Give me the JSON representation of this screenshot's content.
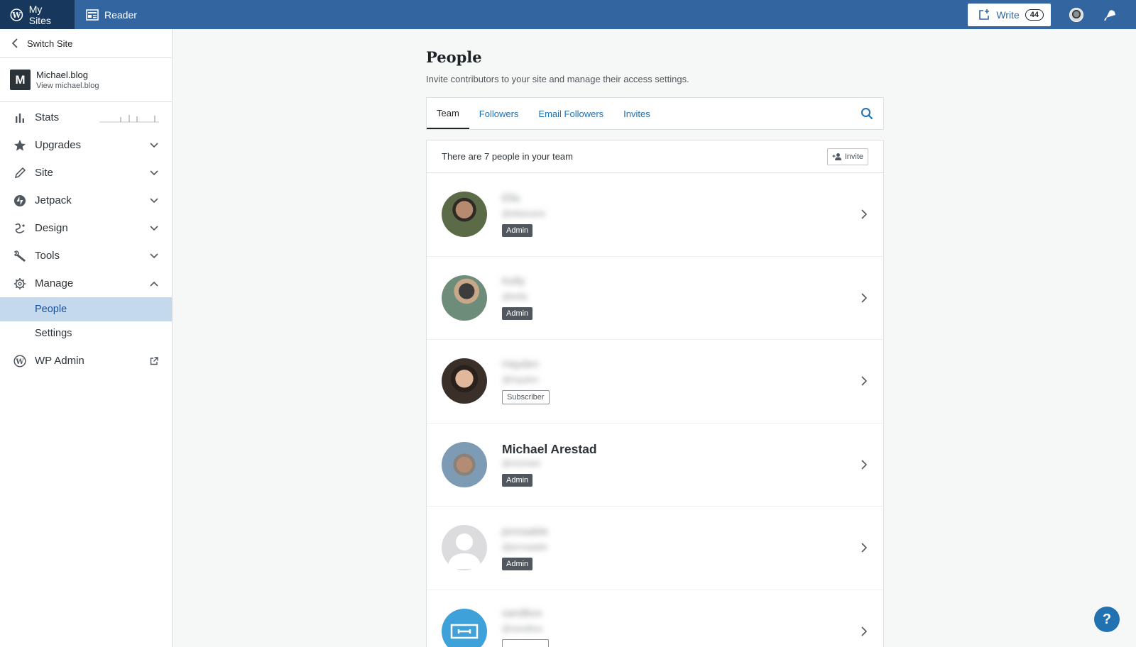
{
  "masterbar": {
    "my_sites": "My Sites",
    "reader": "Reader",
    "write": "Write",
    "write_count": "44"
  },
  "sidebar": {
    "switch_site": "Switch Site",
    "site_title": "Michael.blog",
    "site_url": "View michael.blog",
    "site_letter": "M",
    "items": [
      {
        "label": "Stats",
        "icon": "stats-icon"
      },
      {
        "label": "Upgrades",
        "icon": "star-icon"
      },
      {
        "label": "Site",
        "icon": "pencil-icon"
      },
      {
        "label": "Jetpack",
        "icon": "jetpack-icon"
      },
      {
        "label": "Design",
        "icon": "design-icon"
      },
      {
        "label": "Tools",
        "icon": "wrench-icon"
      },
      {
        "label": "Manage",
        "icon": "gear-icon"
      }
    ],
    "submenu": [
      {
        "label": "People",
        "selected": true
      },
      {
        "label": "Settings"
      }
    ],
    "wp_admin": "WP Admin"
  },
  "main": {
    "title": "People",
    "subtitle": "Invite contributors to your site and manage their access settings.",
    "tabs": [
      "Team",
      "Followers",
      "Email Followers",
      "Invites"
    ],
    "team_count": "There are 7 people in your team",
    "invite": "Invite",
    "people": [
      {
        "name": "Ella",
        "handle": "@ellamarie",
        "role": "Admin"
      },
      {
        "name": "Kelly",
        "handle": "@kelly",
        "role": "Admin"
      },
      {
        "name": "Hayden",
        "handle": "@hayden",
        "role": "Subscriber"
      },
      {
        "name": "Michael Arestad",
        "handle": "@michael",
        "role": "Admin"
      },
      {
        "name": "jennaable",
        "handle": "@jennaable",
        "role": "Admin"
      },
      {
        "name": "sandbox",
        "handle": "@sandbox",
        "role": ""
      }
    ]
  },
  "help": "?",
  "colors": {
    "masterbar": "#3366a1",
    "masterbar_active": "#17385c",
    "link": "#2271b1",
    "selected_bg": "#c5d9ed"
  }
}
